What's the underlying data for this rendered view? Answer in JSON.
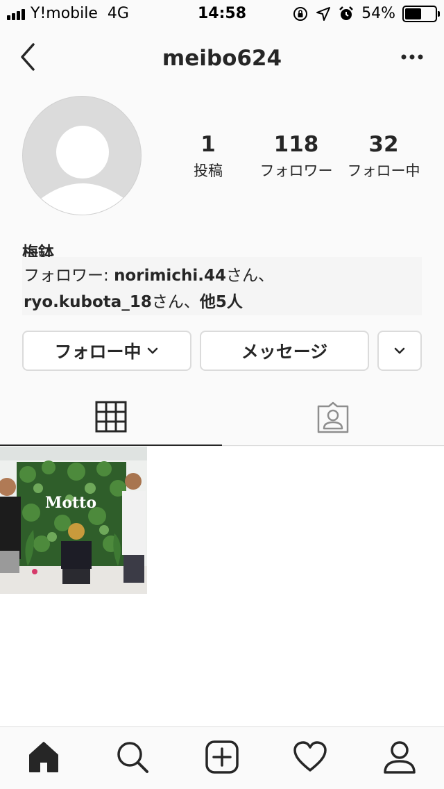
{
  "status_bar": {
    "carrier": "Y!mobile",
    "network": "4G",
    "time": "14:58",
    "battery": "54%",
    "battery_level": 0.54
  },
  "header": {
    "username": "meibo624"
  },
  "profile": {
    "stats": [
      {
        "value": "1",
        "label": "投稿"
      },
      {
        "value": "118",
        "label": "フォロワー"
      },
      {
        "value": "32",
        "label": "フォロー中"
      }
    ],
    "name": "梅鉢",
    "followed_by": {
      "prefix": "フォロワー: ",
      "user1": "norimichi.44",
      "suffix1": "さん、",
      "user2": "ryo.kubota_18",
      "suffix2": "さん、",
      "others": "他5人"
    }
  },
  "buttons": {
    "following": "フォロー中",
    "message": "メッセージ"
  },
  "posts": [
    {
      "sign_text": "Motto"
    }
  ],
  "colors": {
    "text": "#262626",
    "border": "#dbdbdb",
    "background": "#fafafa",
    "avatar_placeholder": "#dbdbdb"
  }
}
